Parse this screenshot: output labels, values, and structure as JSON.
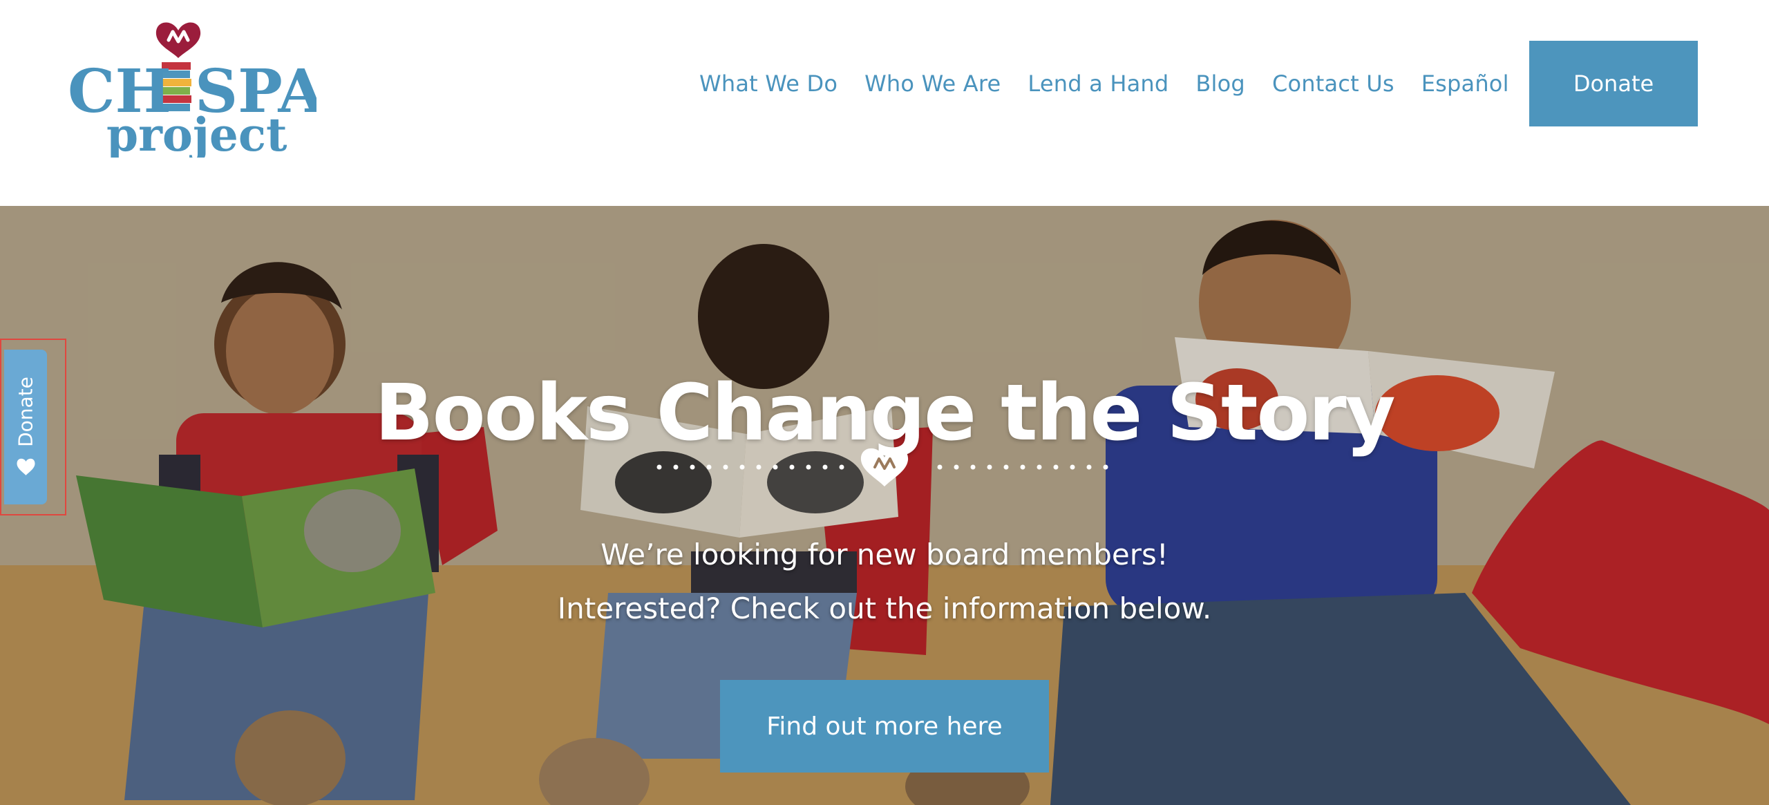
{
  "brand": {
    "logo_text_top": "CHISPA",
    "logo_text_bottom": "project"
  },
  "nav": {
    "items": [
      {
        "label": "What We Do"
      },
      {
        "label": "Who We Are"
      },
      {
        "label": "Lend a Hand"
      },
      {
        "label": "Blog"
      },
      {
        "label": "Contact Us"
      },
      {
        "label": "Español"
      }
    ],
    "donate_label": "Donate"
  },
  "hero": {
    "title": "Books Change the Story",
    "line1": "We’re looking for new board members!",
    "line2": "Interested? Check out the information below.",
    "cta_label": "Find out more here"
  },
  "side_tab": {
    "label": "Donate",
    "icon": "heart-icon"
  },
  "colors": {
    "brand_blue": "#4d95bd",
    "nav_blue": "#4a93bd",
    "logo_heart": "#9b1d3c",
    "tab_blue": "#6aa9d4",
    "highlight_red": "#e0473f"
  }
}
